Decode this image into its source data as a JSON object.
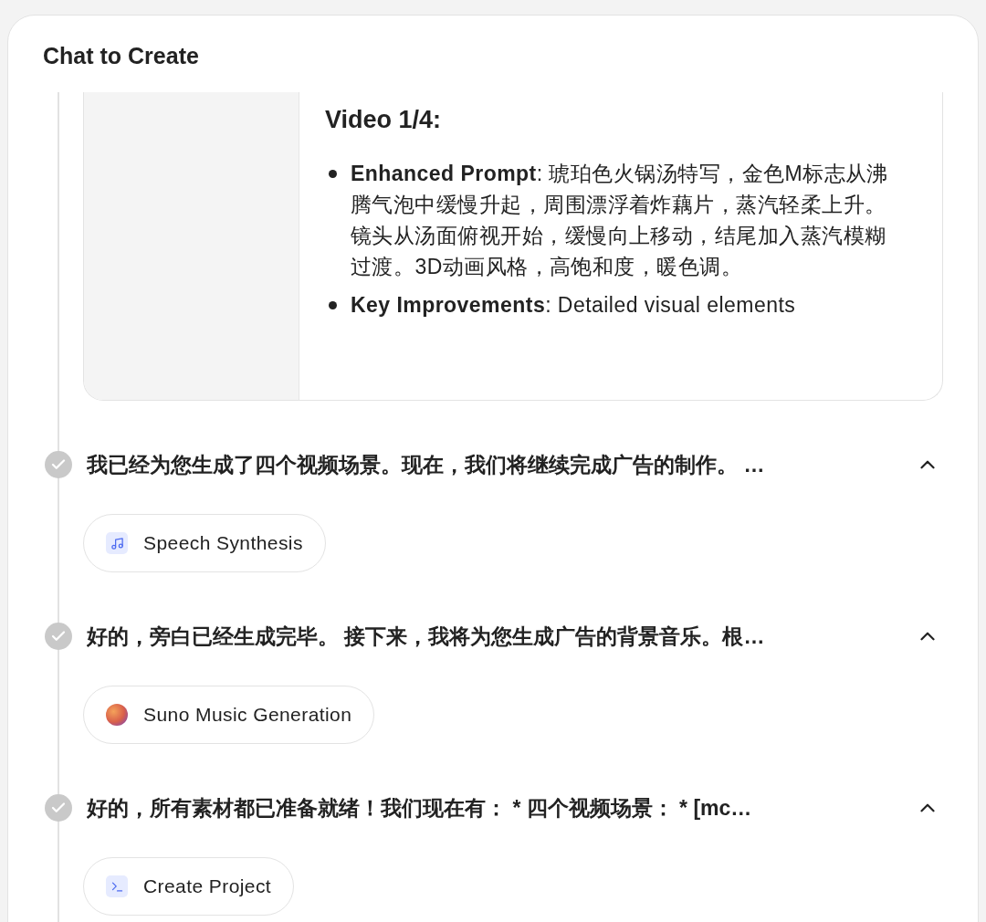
{
  "header": {
    "title": "Chat to Create"
  },
  "video_card": {
    "heading": "Video 1/4:",
    "bullets": [
      {
        "text": "**Enhanced Prompt**: 琥珀色火锅汤特写，金色M标志从沸腾气泡中缓慢升起，周围漂浮着炸藕片，蒸汽轻柔上升。镜头从汤面俯视开始，缓慢向上移动，结尾加入蒸汽模糊过渡。3D动画风格，高饱和度，暖色调。"
      },
      {
        "text": "**Key Improvements**: Detailed visual elements"
      }
    ]
  },
  "steps": [
    {
      "text": "我已经为您生成了四个视频场景。现在，我们将继续完成广告的制作。 …",
      "completed": true,
      "expanded": true,
      "tool": {
        "label": "Speech Synthesis",
        "kind": "music"
      }
    },
    {
      "text": "好的，旁白已经生成完毕。 接下来，我将为您生成广告的背景音乐。根…",
      "completed": true,
      "expanded": true,
      "tool": {
        "label": "Suno Music Generation",
        "kind": "suno"
      }
    },
    {
      "text": "好的，所有素材都已准备就绪！我们现在有： * 四个视频场景： * [mc…",
      "completed": true,
      "expanded": true,
      "tool": {
        "label": "Create Project",
        "kind": "terminal"
      }
    }
  ]
}
